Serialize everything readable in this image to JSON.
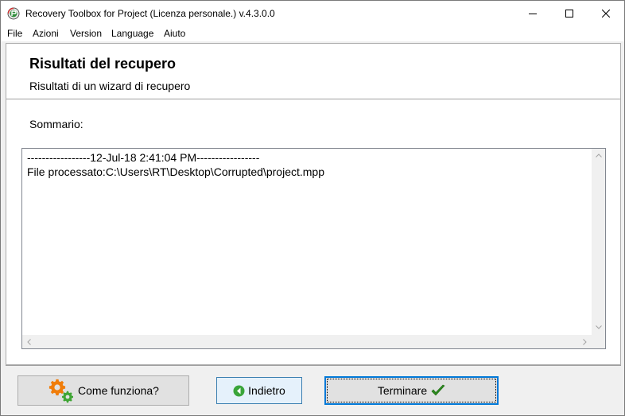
{
  "window": {
    "title": "Recovery Toolbox for Project (Licenza personale.) v.4.3.0.0"
  },
  "menu": [
    "File",
    "Azioni",
    "Version",
    "Language",
    "Aiuto"
  ],
  "header": {
    "title": "Risultati del recupero",
    "subtitle": "Risultati di un wizard di recupero"
  },
  "summary": {
    "label": "Sommario:",
    "log_lines": [
      "-----------------12-Jul-18 2:41:04 PM-----------------",
      "File processato:C:\\Users\\RT\\Desktop\\Corrupted\\project.mpp"
    ]
  },
  "buttons": {
    "help": "Come funziona?",
    "back": "Indietro",
    "finish": "Terminare"
  },
  "colors": {
    "accent": "#0078d7",
    "gear_orange": "#f07d0a",
    "gear_green": "#3fa535",
    "check_green": "#2e8b1f",
    "back_icon_green": "#3aa53a"
  },
  "icons": {
    "app": "recovery-app-icon",
    "minimize": "minimize-icon",
    "maximize": "maximize-icon",
    "close": "close-icon",
    "help": "gears-icon",
    "back": "back-arrow-icon",
    "finish": "checkmark-icon"
  }
}
